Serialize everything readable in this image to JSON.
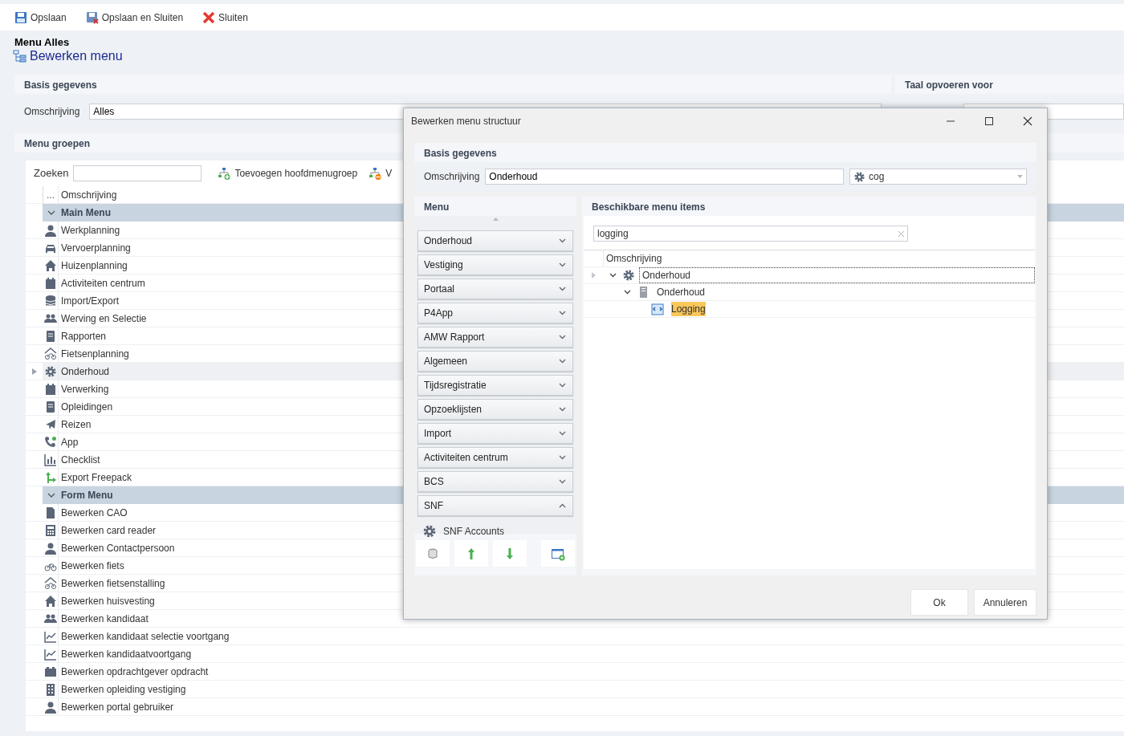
{
  "toolbar": [
    {
      "label": "Opslaan",
      "kind": "save"
    },
    {
      "label": "Opslaan en Sluiten",
      "kind": "save-close"
    },
    {
      "label": "Sluiten",
      "kind": "close"
    }
  ],
  "page_title": "Menu Alles",
  "page_subtitle": "Bewerken menu",
  "basis_panel": {
    "title": "Basis gegevens",
    "field_label": "Omschrijving",
    "field_value": "Alles"
  },
  "taal_panel": {
    "title": "Taal opvoeren voor"
  },
  "groups_panel": {
    "title": "Menu groepen",
    "search_label": "Zoeken",
    "actions": [
      {
        "label": "Toevoegen hoofdmenugroep",
        "kind": "add"
      },
      {
        "label": "V",
        "kind": "remove"
      }
    ],
    "columns": [
      "...",
      "Omschrijving"
    ],
    "groups": [
      {
        "name": "Main Menu",
        "expanded": true,
        "items": [
          {
            "label": "Werkplanning",
            "kind": "person",
            "selected": false
          },
          {
            "label": "Vervoerplanning",
            "kind": "car",
            "selected": false
          },
          {
            "label": "Huizenplanning",
            "kind": "house",
            "selected": false
          },
          {
            "label": "Activiteiten centrum",
            "kind": "calendar",
            "selected": false
          },
          {
            "label": "Import/Export",
            "kind": "database",
            "selected": false
          },
          {
            "label": "Werving en Selectie",
            "kind": "people",
            "selected": false
          },
          {
            "label": "Rapporten",
            "kind": "book",
            "selected": false
          },
          {
            "label": "Fietsenplanning",
            "kind": "bike-house",
            "selected": false
          },
          {
            "label": "Onderhoud",
            "kind": "gear",
            "selected": true
          },
          {
            "label": "Verwerking",
            "kind": "calendar",
            "selected": false
          },
          {
            "label": "Opleidingen",
            "kind": "book",
            "selected": false
          },
          {
            "label": "Reizen",
            "kind": "plane",
            "selected": false
          },
          {
            "label": "App",
            "kind": "phone",
            "selected": false
          },
          {
            "label": "Checklist",
            "kind": "bar-chart",
            "selected": false
          },
          {
            "label": "Export Freepack",
            "kind": "arrow",
            "selected": false
          }
        ]
      },
      {
        "name": "Form Menu",
        "expanded": true,
        "items": [
          {
            "label": "Bewerken CAO",
            "kind": "document",
            "selected": false
          },
          {
            "label": "Bewerken card reader",
            "kind": "calculator",
            "selected": false
          },
          {
            "label": "Bewerken Contactpersoon",
            "kind": "person",
            "selected": false
          },
          {
            "label": "Bewerken fiets",
            "kind": "bike",
            "selected": false
          },
          {
            "label": "Bewerken fietsenstalling",
            "kind": "bike-house",
            "selected": false
          },
          {
            "label": "Bewerken huisvesting",
            "kind": "house",
            "selected": false
          },
          {
            "label": "Bewerken kandidaat",
            "kind": "people",
            "selected": false
          },
          {
            "label": "Bewerken kandidaat selectie voortgang",
            "kind": "line-chart",
            "selected": false
          },
          {
            "label": "Bewerken kandidaatvoortgang",
            "kind": "line-chart",
            "selected": false
          },
          {
            "label": "Bewerken opdrachtgever opdracht",
            "kind": "briefcase",
            "selected": false
          },
          {
            "label": "Bewerken opleiding vestiging",
            "kind": "building",
            "selected": false
          },
          {
            "label": "Bewerken portal gebruiker",
            "kind": "person",
            "selected": false
          }
        ]
      }
    ]
  },
  "dialog": {
    "title": "Bewerken menu structuur",
    "basis": {
      "title": "Basis gegevens",
      "field_label": "Omschrijving",
      "field_value": "Onderhoud",
      "icon_value": "cog"
    },
    "menu": {
      "title": "Menu",
      "groups": [
        {
          "label": "Onderhoud",
          "expanded": false
        },
        {
          "label": "Vestiging",
          "expanded": false
        },
        {
          "label": "Portaal",
          "expanded": false
        },
        {
          "label": "P4App",
          "expanded": false
        },
        {
          "label": "AMW Rapport",
          "expanded": false
        },
        {
          "label": "Algemeen",
          "expanded": false
        },
        {
          "label": "Tijdsregistratie",
          "expanded": false
        },
        {
          "label": "Opzoeklijsten",
          "expanded": false
        },
        {
          "label": "Import",
          "expanded": false
        },
        {
          "label": "Activiteiten centrum",
          "expanded": false
        },
        {
          "label": "BCS",
          "expanded": false
        },
        {
          "label": "SNF",
          "expanded": true,
          "children": [
            {
              "label": "SNF Accounts"
            }
          ]
        }
      ]
    },
    "available": {
      "title": "Beschikbare menu items",
      "search_value": "logging",
      "column": "Omschrijving",
      "tree": [
        {
          "label": "Onderhoud",
          "kind": "gear",
          "selected": true,
          "expanded": true,
          "highlighted": false,
          "children": [
            {
              "label": "Onderhoud",
              "kind": "server",
              "selected": false,
              "expanded": true,
              "highlighted": false,
              "children": [
                {
                  "label": "Logging",
                  "kind": "code-file",
                  "selected": false,
                  "expanded": false,
                  "highlighted": true
                }
              ]
            }
          ]
        }
      ]
    },
    "buttons": [
      "Ok",
      "Annuleren"
    ]
  }
}
